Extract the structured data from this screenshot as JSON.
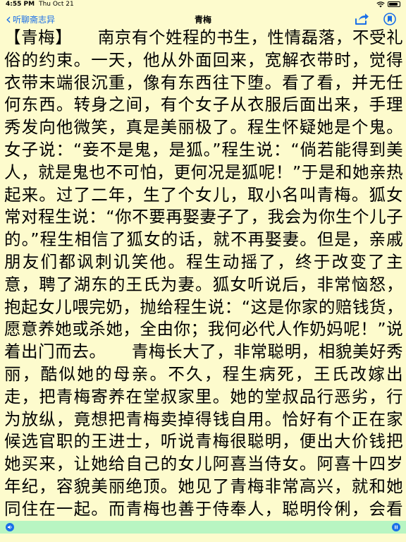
{
  "status_bar": {
    "time": "4:55 PM",
    "date": "Thu Oct 21",
    "battery_fill_fraction": 0.85
  },
  "nav": {
    "back_label": "听聊斋志异",
    "title": "青梅",
    "share_icon": "share-icon",
    "bookmark_icon": "bookmark-icon",
    "accent_color": "#1a6fe8"
  },
  "content": {
    "text": "【青梅】　　南京有个姓程的书生，性情磊落，不受礼俗的约束。一天，他从外面回来，宽解衣带时，觉得衣带末端很沉重，像有东西往下堕。看了看，并无任何东西。转身之间，有个女子从衣服后面出来，手理秀发向他微笑，真是美丽极了。程生怀疑她是个鬼。女子说：“妾不是鬼，是狐。”程生说：“倘若能得到美人，就是鬼也不可怕，更何况是狐呢！”于是和她亲热起来。过了二年，生了个女儿，取小名叫青梅。狐女常对程生说：“你不要再娶妻子了，我会为你生个儿子的。”程生相信了狐女的话，就不再娶妻。但是，亲戚朋友们都讽刺讥笑他。程生动摇了，终于改变了主意，聘了湖东的王氏为妻。狐女听说后，非常恼怒，抱起女儿喂完奶，抛给程生说：“这是你家的赔钱货，愿意养她或杀她，全由你；我何必代人作奶妈呢！”说着出门而去。　　青梅长大了，非常聪明，相貌美好秀丽，酷似她的母亲。不久，程生病死，王氏改嫁出走，把青梅寄养在堂叔家里。她的堂叔品行恶劣，行为放纵，竟想把青梅卖掉得钱自用。恰好有个正在家候选官职的王进士，听说青梅很聪明，便出大价钱把她买来，让她给自己的女儿阿喜当侍女。阿喜十四岁年纪，容貌美丽绝顶。她见了青梅非常高兴，就和她同住在一起。而青梅也善于侍奉人，聪明伶俐，会看眼眉行事，因此王家人全都喜爱她。　　城里有个姓张的书生，字介受，家境贫穷，没有财产，租赁了王进士的房子居住。张生非常孝顺，"
  },
  "bottom_bar": {
    "background": "#b8f5c2",
    "left_icon": "speaker-icon",
    "right_icon": "pause-icon"
  },
  "theme": {
    "page_background": "#fdfbcd"
  }
}
